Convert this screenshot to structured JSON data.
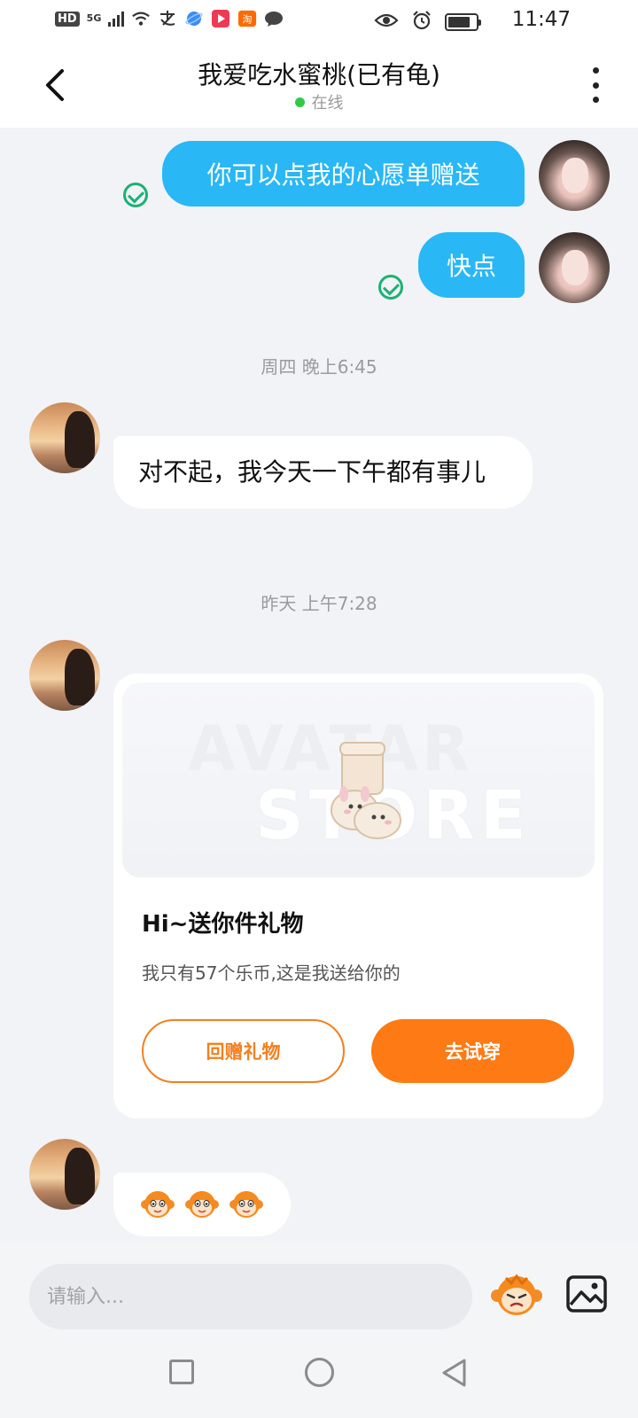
{
  "status_bar": {
    "network_hd": "HD",
    "network_5g": "5G",
    "time": "11:47",
    "icons": [
      "signal-icon",
      "wifi-icon",
      "alipay-icon",
      "browser-icon",
      "video-app-icon",
      "taobao-icon",
      "chat-app-icon",
      "eye-icon",
      "alarm-icon",
      "battery-icon"
    ]
  },
  "header": {
    "title": "我爱吃水蜜桃(已有龟)",
    "status": "在线",
    "status_color": "#2fca46"
  },
  "messages": {
    "out1": "你可以点我的心愿单赠送",
    "out2": "快点",
    "time1": "周四 晚上6:45",
    "in1": "对不起，我今天一下午都有事儿",
    "time2": "昨天 上午7:28"
  },
  "gift_card": {
    "watermark_1": "AVATAR",
    "watermark_2": "STORE",
    "title": "Hi~送你件礼物",
    "description": "我只有57个乐币,这是我送给你的",
    "button_return": "回赠礼物",
    "button_try": "去试穿",
    "accent_color": "#fd7a14"
  },
  "emoji_message": {
    "emoji_count": 3,
    "emoji_name": "monkey-emoji-icon"
  },
  "input": {
    "placeholder": "请输入..."
  },
  "colors": {
    "bubble_out": "#29b7f5",
    "read_check": "#1eb073",
    "background": "#f1f3f7"
  }
}
